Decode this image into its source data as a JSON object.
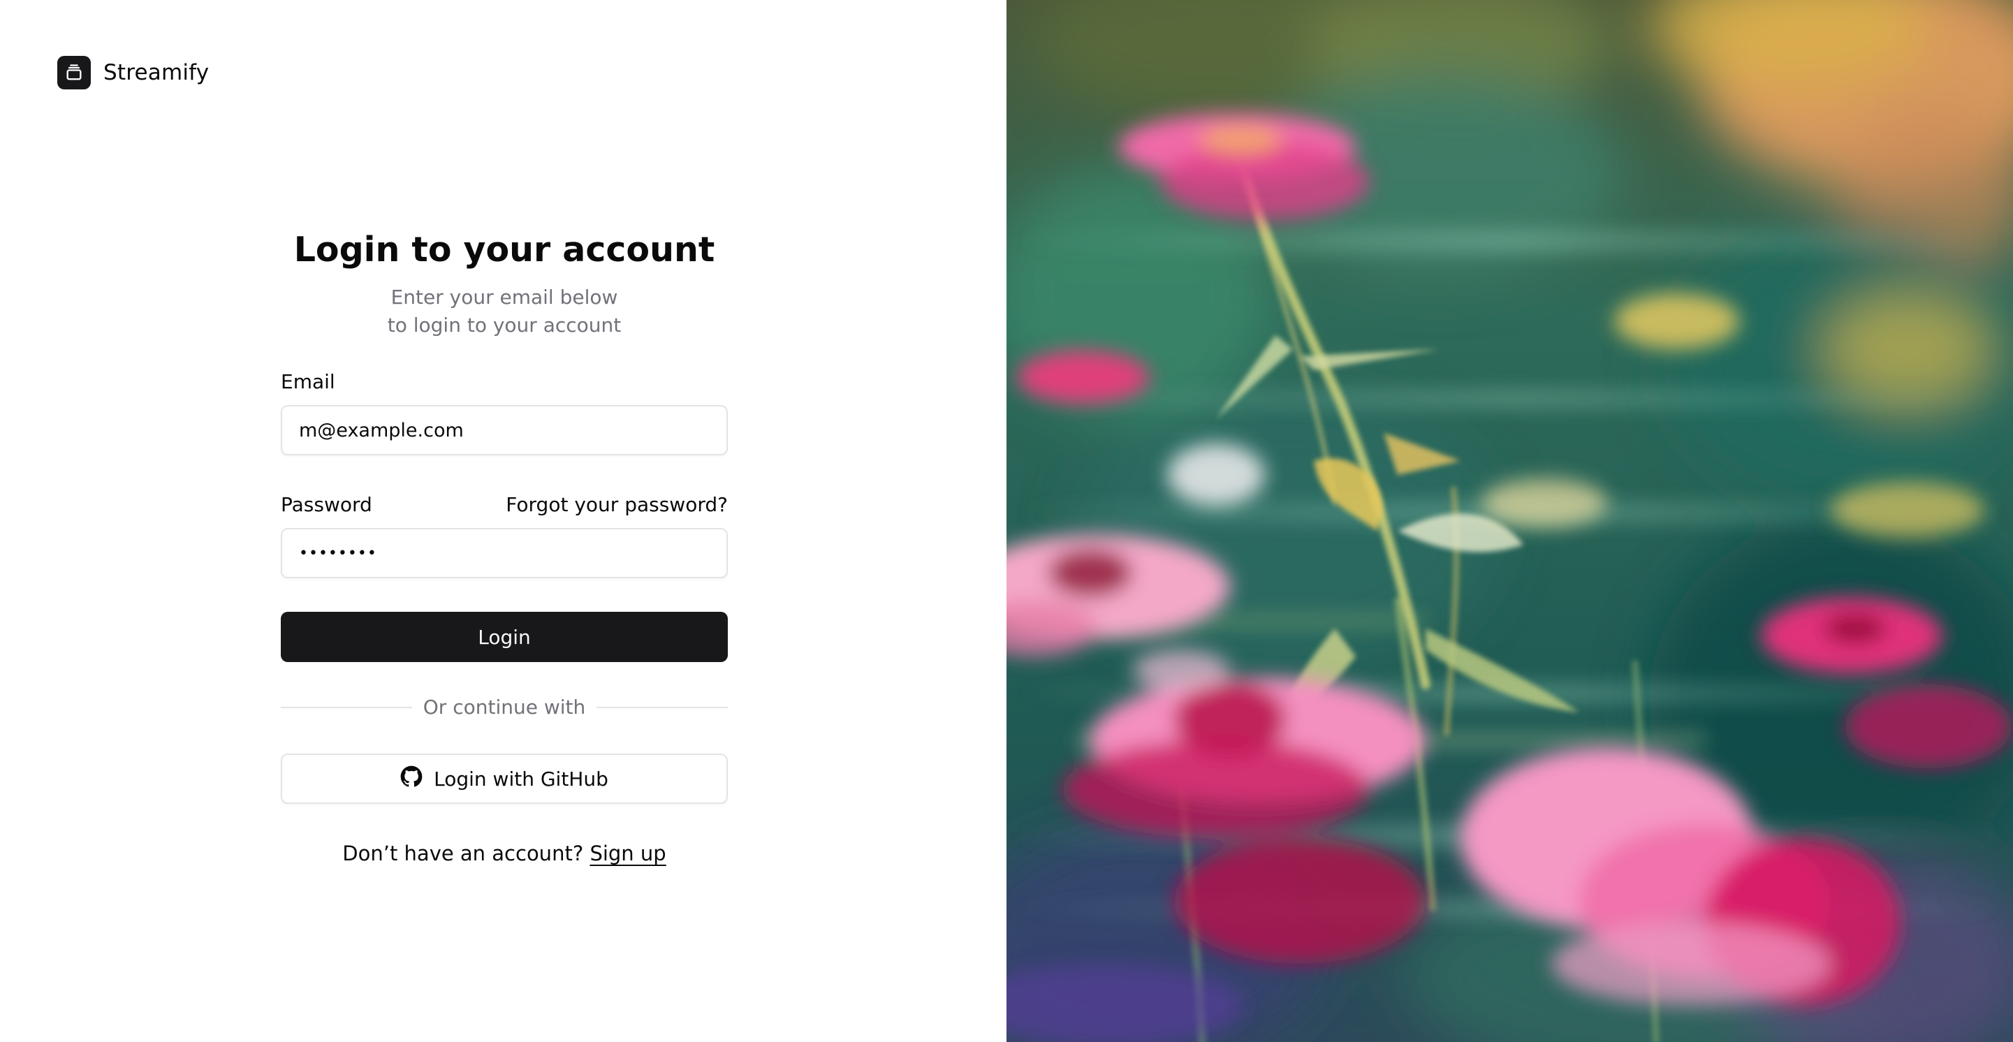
{
  "brand": {
    "name": "Streamify",
    "icon": "inbox-icon"
  },
  "login": {
    "title": "Login to your account",
    "subtitle_line1": "Enter your email below",
    "subtitle_line2": "to login to your account",
    "email_label": "Email",
    "email_value": "m@example.com",
    "password_label": "Password",
    "forgot_link": "Forgot your password?",
    "password_value": "••••••••",
    "login_button": "Login",
    "divider_text": "Or continue with",
    "github_button": "Login with GitHub",
    "github_icon": "github-icon",
    "signup_prompt": "Don’t have an account?",
    "signup_link": "Sign up"
  },
  "hero_image": {
    "description_icon": "flowers-photo",
    "colors": {
      "foliage": "#2f6b5a",
      "pink": "#f06ba8",
      "magenta": "#d4145a",
      "yellow": "#e8c85a",
      "orange": "#e89a4a"
    }
  },
  "colors": {
    "primary": "#18181b",
    "muted": "#71717a",
    "border": "#e4e4e7"
  }
}
